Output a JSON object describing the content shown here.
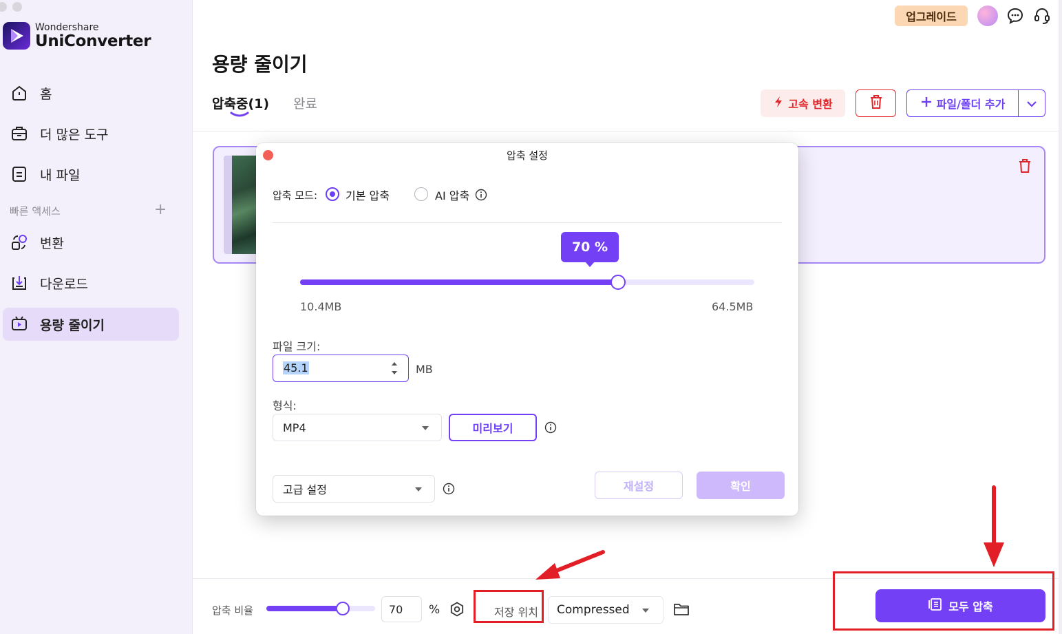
{
  "sidebar": {
    "brand_sub": "Wondershare",
    "brand_main": "UniConverter",
    "nav": [
      {
        "label": "홈",
        "icon": "home-icon"
      },
      {
        "label": "더 많은 도구",
        "icon": "toolbox-icon"
      },
      {
        "label": "내 파일",
        "icon": "file-icon"
      }
    ],
    "quick_access_label": "빠른 액세스",
    "quick_nav": [
      {
        "label": "변환",
        "icon": "convert-icon"
      },
      {
        "label": "다운로드",
        "icon": "download-icon"
      },
      {
        "label": "용량 줄이기",
        "icon": "compress-icon",
        "active": true
      }
    ]
  },
  "topbar": {
    "upgrade_label": "업그레이드"
  },
  "main": {
    "title": "용량 줄이기",
    "tabs": [
      {
        "label": "압축중(1)",
        "active": true
      },
      {
        "label": "완료",
        "active": false
      }
    ],
    "fast_convert_label": "고속 변환",
    "add_files_label": "파일/폴더 추가"
  },
  "dialog": {
    "title": "압축 설정",
    "mode_label": "압축 모드:",
    "mode_options": [
      "기본 압축",
      "AI 압축"
    ],
    "mode_selected": "기본 압축",
    "percent_label": "70 %",
    "slider_percent": 70,
    "size_min": "10.4MB",
    "size_max": "64.5MB",
    "file_size_label": "파일 크기:",
    "file_size_value": "45.1",
    "file_size_unit": "MB",
    "format_label": "형식:",
    "format_value": "MP4",
    "preview_label": "미리보기",
    "advanced_label": "고급 설정",
    "reset_label": "재설정",
    "ok_label": "확인"
  },
  "bottom": {
    "ratio_label": "압축 비율",
    "ratio_value": "70",
    "ratio_percent": 70,
    "percent_sign": "%",
    "save_location_label": "저장 위치",
    "save_location_value": "Compressed",
    "compress_all_label": "모두 압축"
  },
  "colors": {
    "accent": "#7440f6",
    "danger": "#e0262a",
    "annotation": "#e21f26",
    "sidebar_bg": "#f4f0fb"
  }
}
